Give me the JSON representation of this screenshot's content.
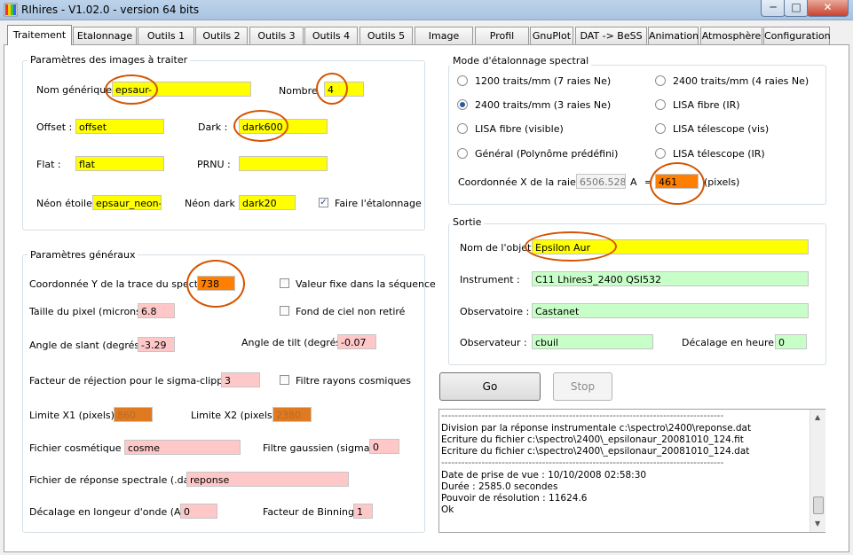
{
  "window": {
    "title": "RIhires - V1.02.0 - version 64 bits",
    "min_glyph": "─",
    "max_glyph": "□",
    "close_glyph": "✕"
  },
  "tabs": [
    "Traitement",
    "Etalonnage",
    "Outils 1",
    "Outils 2",
    "Outils 3",
    "Outils 4",
    "Outils 5",
    "Image",
    "Profil",
    "GnuPlot",
    "DAT -> BeSS",
    "Animation",
    "Atmosphère",
    "Configuration"
  ],
  "images": {
    "legend": "Paramètres des images à traiter",
    "nom_label": "Nom générique :",
    "nom_value": "epsaur-",
    "nombre_label": "Nombre",
    "nombre_value": "4",
    "offset_label": "Offset :",
    "offset_value": "offset",
    "dark_label": "Dark :",
    "dark_value": "dark600",
    "flat_label": "Flat :",
    "flat_value": "flat",
    "prnu_label": "PRNU :",
    "prnu_value": "",
    "neon_etoile_label": "Néon étoile :",
    "neon_etoile_value": "epsaur_neon-1",
    "neon_dark_label": "Néon dark :",
    "neon_dark_value": "dark20",
    "etalonnage_label": "Faire l'étalonnage",
    "etalonnage_checked": true
  },
  "general": {
    "legend": "Paramètres généraux",
    "coord_y_label": "Coordonnée Y de la trace du spectre",
    "coord_y_value": "738",
    "valeur_fixe_label": "Valeur fixe dans la séquence",
    "taille_pixel_label": "Taille du pixel (microns) :",
    "taille_pixel_value": "6.8",
    "fond_ciel_label": "Fond de ciel non retiré",
    "slant_label": "Angle de slant (degrés) :",
    "slant_value": "-3.29",
    "tilt_label": "Angle de tilt (degrés) :",
    "tilt_value": "-0.07",
    "rejection_label": "Facteur de réjection pour le sigma-clipping :",
    "rejection_value": "3",
    "cosmiques_label": "Filtre rayons cosmiques",
    "x1_label": "Limite X1 (pixels) :",
    "x1_value": "860",
    "x2_label": "Limite X2 (pixels) :",
    "x2_value": "2380",
    "cosmetique_label": "Fichier cosmétique :",
    "cosmetique_value": "cosme",
    "gaussien_label": "Filtre gaussien (sigma) :",
    "gaussien_value": "0",
    "reponse_label": "Fichier de réponse spectrale (.dat) :",
    "reponse_value": "reponse",
    "decalage_lo_label": "Décalage en longeur d'onde (A) :",
    "decalage_lo_value": "0",
    "binning_label": "Facteur de Binning :",
    "binning_value": "1"
  },
  "spectral": {
    "legend": "Mode d'étalonnage spectral",
    "options": [
      "1200 traits/mm (7 raies Ne)",
      "2400 traits/mm (4 raies Ne)",
      "2400 traits/mm (3 raies Ne)",
      "LISA fibre (IR)",
      "LISA fibre (visible)",
      "LISA télescope (vis)",
      "Général (Polynôme prédéfini)",
      "LISA télescope (IR)"
    ],
    "coord_x_label": "Coordonnée X de la raie à",
    "coord_x_value": "6506.528",
    "a_label": "A",
    "eq_label": "=",
    "a_value": "461",
    "pixels_label": "(pixels)"
  },
  "sortie": {
    "legend": "Sortie",
    "objet_label": "Nom de l'objet :",
    "objet_value": "Epsilon Aur",
    "instrument_label": "Instrument :",
    "instrument_value": "C11 Lhires3_2400 QSI532",
    "observatoire_label": "Observatoire :",
    "observatoire_value": "Castanet",
    "observateur_label": "Observateur :",
    "observateur_value": "cbuil",
    "decalage_heure_label": "Décalage en heure :",
    "decalage_heure_value": "0"
  },
  "actions": {
    "go": "Go",
    "stop": "Stop"
  },
  "log": [
    "------------------------------------------------------------------------------------",
    "Division par la réponse instrumentale c:\\spectro\\2400\\reponse.dat",
    "Ecriture du fichier c:\\spectro\\2400\\_epsilonaur_20081010_124.fit",
    "Ecriture du fichier c:\\spectro\\2400\\_epsilonaur_20081010_124.dat",
    "------------------------------------------------------------------------------------",
    "Date de prise de vue : 10/10/2008 02:58:30",
    "Durée : 2585.0 secondes",
    "Pouvoir de résolution : 11624.6",
    "Ok"
  ]
}
